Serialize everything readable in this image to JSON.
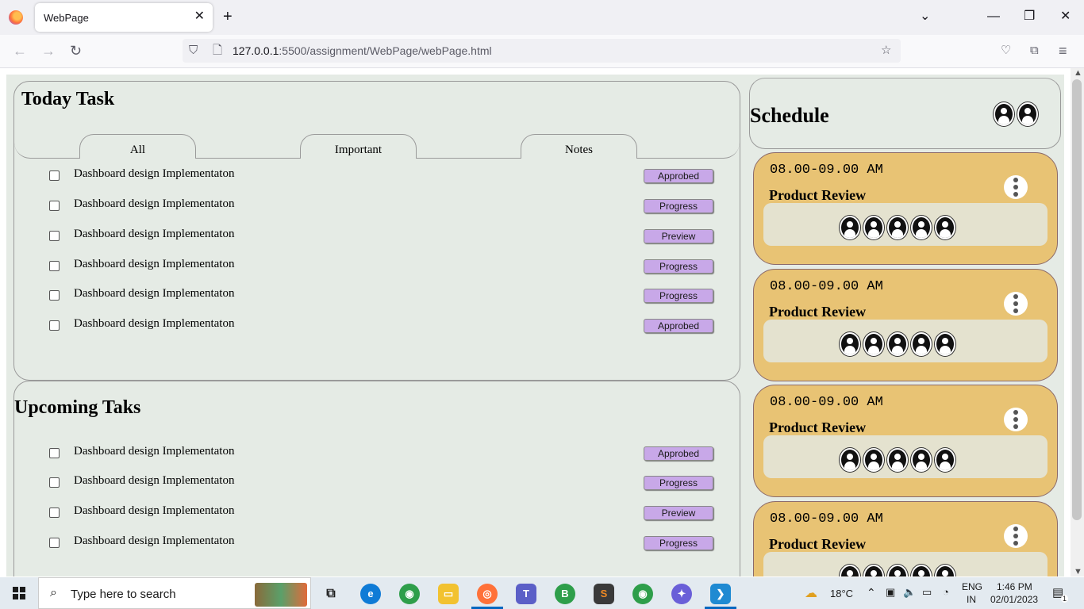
{
  "browser": {
    "tab_title": "WebPage",
    "url_host": "127.0.0.1",
    "url_rest": ":5500/assignment/WebPage/webPage.html"
  },
  "today": {
    "title": "Today Task",
    "tabs": [
      "All",
      "Important",
      "Notes"
    ],
    "tasks": [
      {
        "label": "Dashboard design Implementaton",
        "status": "Approbed"
      },
      {
        "label": "Dashboard design Implementaton",
        "status": "Progress"
      },
      {
        "label": "Dashboard design Implementaton",
        "status": "Preview"
      },
      {
        "label": "Dashboard design Implementaton",
        "status": "Progress"
      },
      {
        "label": "Dashboard design Implementaton",
        "status": "Progress"
      },
      {
        "label": "Dashboard design Implementaton",
        "status": "Approbed"
      }
    ]
  },
  "upcoming": {
    "title": "Upcoming Taks",
    "tasks": [
      {
        "label": "Dashboard design Implementaton",
        "status": "Approbed"
      },
      {
        "label": "Dashboard design Implementaton",
        "status": "Progress"
      },
      {
        "label": "Dashboard design Implementaton",
        "status": "Preview"
      },
      {
        "label": "Dashboard design Implementaton",
        "status": "Progress"
      }
    ]
  },
  "schedule": {
    "title": "Schedule",
    "cards": [
      {
        "time": "08.00-09.00 AM",
        "name": "Product Review"
      },
      {
        "time": "08.00-09.00 AM",
        "name": "Product Review"
      },
      {
        "time": "08.00-09.00 AM",
        "name": "Product Review"
      },
      {
        "time": "08.00-09.00 AM",
        "name": "Product Review"
      }
    ]
  },
  "taskbar": {
    "search_placeholder": "Type here to search",
    "weather": "18°C",
    "lang1": "ENG",
    "lang2": "IN",
    "time": "1:46 PM",
    "date": "02/01/2023",
    "notifications": "1"
  },
  "colors": {
    "page_bg": "#e5ebe5",
    "badge": "#c8a8e8",
    "card": "#e8c374",
    "card_inner": "#e4e2cf"
  }
}
